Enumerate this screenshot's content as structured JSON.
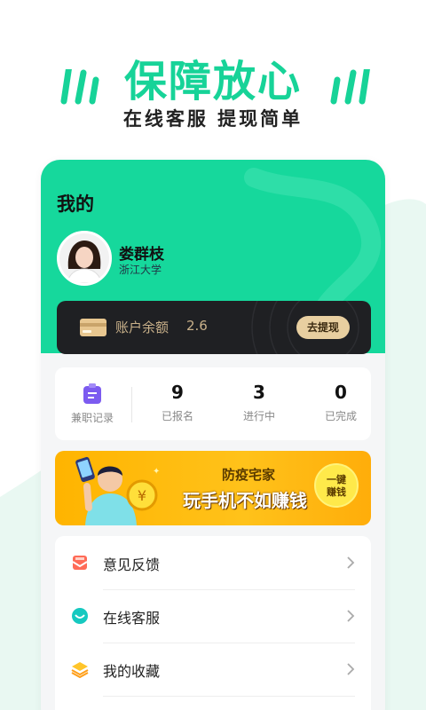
{
  "promo": {
    "title": "保障放心",
    "subtitle": "在线客服 提现简单"
  },
  "profile": {
    "page_title": "我的",
    "name": "娄群枝",
    "school": "浙江大学"
  },
  "balance": {
    "label": "账户余额",
    "value": "2.6",
    "withdraw_label": "去提现"
  },
  "stats": {
    "records_label": "兼职记录",
    "items": [
      {
        "value": "9",
        "label": "已报名"
      },
      {
        "value": "3",
        "label": "进行中"
      },
      {
        "value": "0",
        "label": "已完成"
      }
    ]
  },
  "banner": {
    "subtitle": "防疫宅家",
    "title": "玩手机不如赚钱",
    "button_line1": "一键",
    "button_line2": "赚钱"
  },
  "menu": [
    {
      "label": "意见反馈",
      "icon": "feedback-icon"
    },
    {
      "label": "在线客服",
      "icon": "chat-icon"
    },
    {
      "label": "我的收藏",
      "icon": "layers-icon"
    }
  ],
  "colors": {
    "brand_green": "#16d89c",
    "gold": "#c9b18a",
    "banner_yellow": "#ffb400"
  }
}
